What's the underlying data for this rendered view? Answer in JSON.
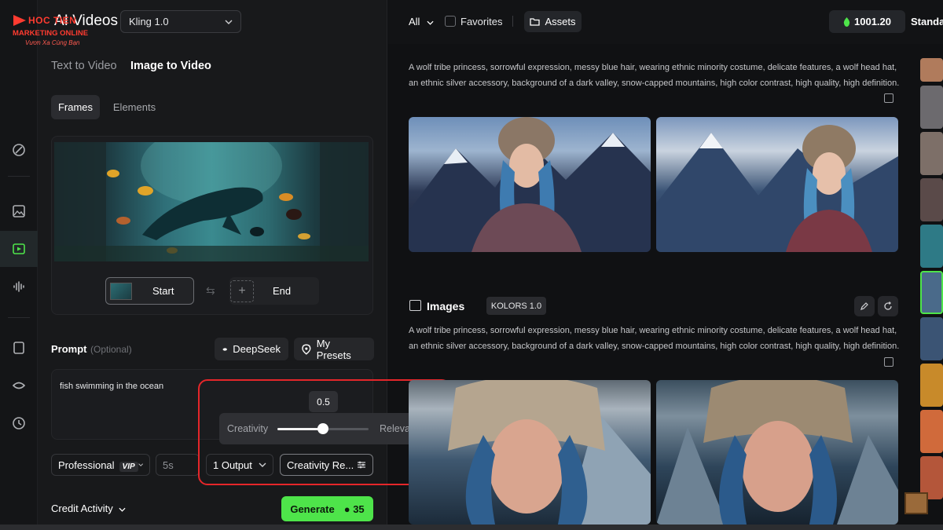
{
  "logo": {
    "brand": "HOC TIEN",
    "sub": "MARKETING ONLINE",
    "tag": "Vươn Xa Cùng Bạn"
  },
  "header": {
    "title": "AI Videos",
    "model": "Kling 1.0"
  },
  "tabs": [
    "Text to Video",
    "Image to Video"
  ],
  "subtabs": [
    "Frames",
    "Elements"
  ],
  "frames": {
    "start_label": "Start",
    "end_label": "End"
  },
  "prompt": {
    "label": "Prompt",
    "optional": "(Optional)",
    "deepseek": "DeepSeek",
    "presets": "My Presets",
    "text": "fish swimming in the ocean"
  },
  "controls": {
    "mode": "Professional",
    "vip": "VIP",
    "duration": "5s",
    "outputs": "1 Output",
    "creativity": "Creativity Re..."
  },
  "slider": {
    "left": "Creativity",
    "right": "Relevance",
    "value": "0.5",
    "fraction": 0.5
  },
  "footer": {
    "credit": "Credit Activity",
    "generate": "Generate",
    "cost": "35"
  },
  "topbar": {
    "all": "All",
    "favorites": "Favorites",
    "assets": "Assets",
    "credits": "1001.20",
    "plan": "Standa"
  },
  "feed": {
    "desc1": "A wolf tribe princess, sorrowful expression, messy blue hair, wearing ethnic minority costume, delicate features, a wolf head hat, an ethnic silver accessory, background of a dark valley, snow-capped mountains, high color contrast, high quality, high definition.",
    "section_title": "Images",
    "badge": "KOLORS 1.0",
    "desc2": "A wolf tribe princess, sorrowful expression, messy blue hair, wearing ethnic minority costume, delicate features, a wolf head hat, an ethnic silver accessory, background of a dark valley, snow-capped mountains, high color contrast, high quality, high definition."
  },
  "colors": {
    "accent": "#4ee44a",
    "highlight": "#e5262a"
  }
}
